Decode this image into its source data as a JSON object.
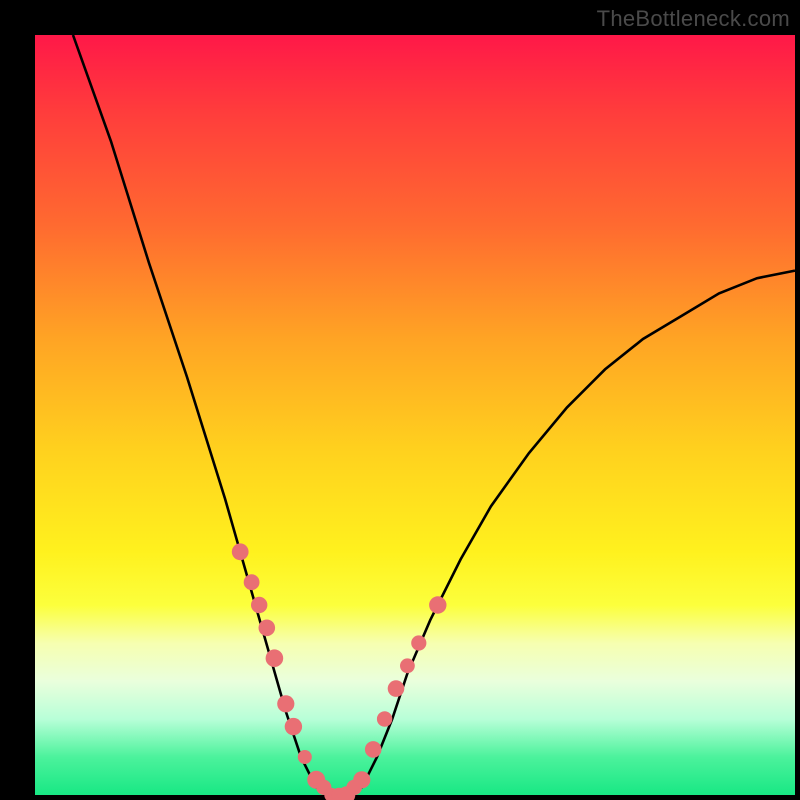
{
  "watermark": "TheBottleneck.com",
  "colors": {
    "frame": "#000000",
    "curve": "#000000",
    "marker_fill": "#e96f74",
    "marker_stroke": "#c95b60"
  },
  "chart_data": {
    "type": "line",
    "title": "",
    "xlabel": "",
    "ylabel": "",
    "xlim": [
      0,
      100
    ],
    "ylim": [
      0,
      100
    ],
    "grid": false,
    "legend": false,
    "note": "V-shaped bottleneck curve; y is estimated bottleneck percentage, x is relative performance position. Minimum (0%) around x ≈ 36–42. Values estimated from pixel heights.",
    "series": [
      {
        "name": "bottleneck-curve",
        "x": [
          5,
          10,
          15,
          20,
          25,
          27,
          29,
          31,
          33,
          35,
          37,
          39,
          41,
          43,
          45,
          47,
          49,
          52,
          56,
          60,
          65,
          70,
          75,
          80,
          85,
          90,
          95,
          100
        ],
        "y": [
          100,
          86,
          70,
          55,
          39,
          32,
          25,
          18,
          11,
          5,
          1,
          0,
          0,
          1,
          5,
          10,
          16,
          23,
          31,
          38,
          45,
          51,
          56,
          60,
          63,
          66,
          68,
          69
        ]
      }
    ],
    "markers": {
      "name": "highlighted-points",
      "note": "Pink circular markers clustered near the minimum on both branches.",
      "x": [
        27,
        28.5,
        29.5,
        30.5,
        31.5,
        33,
        34,
        35.5,
        37,
        38,
        39,
        40,
        41,
        42,
        43,
        44.5,
        46,
        47.5,
        49,
        50.5,
        53
      ],
      "y": [
        32,
        28,
        25,
        22,
        18,
        12,
        9,
        5,
        2,
        1,
        0,
        0,
        0,
        1,
        2,
        6,
        10,
        14,
        17,
        20,
        25
      ]
    }
  }
}
